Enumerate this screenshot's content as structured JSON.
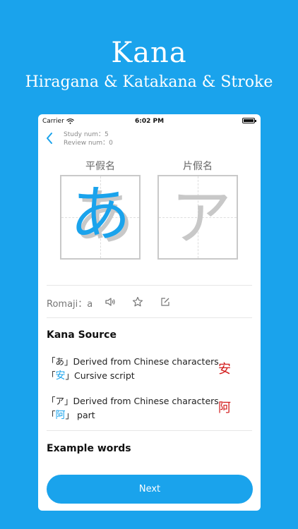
{
  "promo": {
    "title": "Kana",
    "subtitle": "Hiragana & Katakana & Stroke"
  },
  "status_bar": {
    "carrier": "Carrier",
    "time": "6:02 PM",
    "icons": [
      "wifi-icon",
      "battery-icon"
    ]
  },
  "header": {
    "back_icon": "chevron-left-icon",
    "study_num": "Study num：5",
    "review_num": "Review num：0"
  },
  "kana": {
    "hiragana_label": "平假名",
    "katakana_label": "片假名",
    "hiragana_char": "あ",
    "katakana_char": "ア"
  },
  "romaji": {
    "text": "Romaji：a",
    "icons": [
      "speaker-icon",
      "star-icon",
      "edit-icon"
    ]
  },
  "kana_source": {
    "title": "Kana Source",
    "hiragana": {
      "line1_prefix": "「あ」",
      "line1_text": "Derived from Chinese characters",
      "line2_open": "「",
      "line2_char": "安",
      "line2_close": "」",
      "line2_text": "Cursive script",
      "origin_char": "安"
    },
    "katakana": {
      "line1_prefix": "「ア」",
      "line1_text": "Derived from Chinese characters",
      "line2_open": "「",
      "line2_char": "阿",
      "line2_close": "」",
      "line2_text": " part",
      "origin_char": "阿"
    }
  },
  "example_words": {
    "title": "Example words"
  },
  "next_button": {
    "label": "Next"
  },
  "colors": {
    "accent": "#1aa3ec",
    "origin_red": "#d21a1a"
  }
}
